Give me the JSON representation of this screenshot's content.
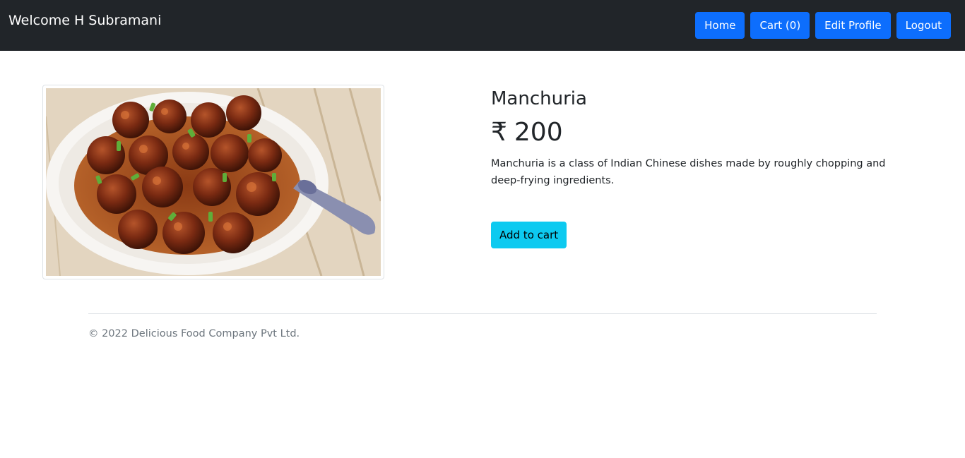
{
  "navbar": {
    "brand": "Welcome H Subramani",
    "buttons": {
      "home": "Home",
      "cart": "Cart (0)",
      "edit_profile": "Edit Profile",
      "logout": "Logout"
    }
  },
  "product": {
    "name": "Manchuria",
    "currency_symbol": "₹",
    "price": "200",
    "description": "Manchuria is a class of Indian Chinese dishes made by roughly chopping and deep-frying ingredients.",
    "add_to_cart": "Add to cart"
  },
  "footer": {
    "copyright": "© 2022 Delicious Food Company Pvt Ltd."
  },
  "colors": {
    "navbar_bg": "#212529",
    "primary": "#0d6efd",
    "info": "#0dcaf0",
    "muted": "#6c757d"
  }
}
